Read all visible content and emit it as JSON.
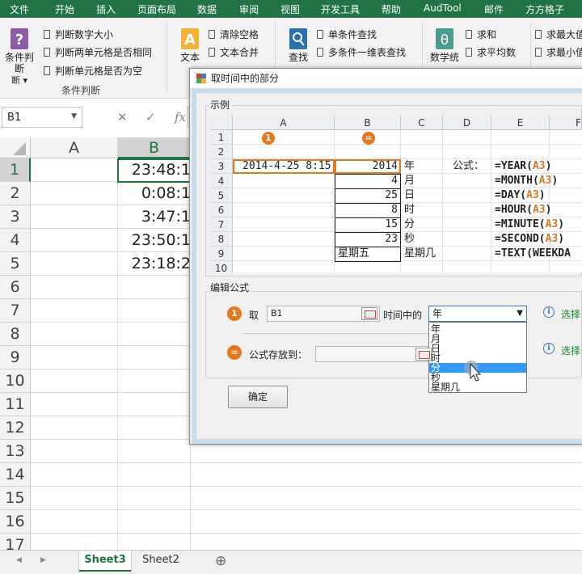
{
  "ribbon_tabs": [
    "文件",
    "开始",
    "插入",
    "页面布局",
    "数据",
    "审阅",
    "视图",
    "开发工具",
    "帮助",
    "AudTool",
    "邮件",
    "方方格子"
  ],
  "ribbon": {
    "cond_button": "条件判断",
    "cond_items": [
      "判断数字大小",
      "判断两单元格是否相同",
      "判断单元格是否为空"
    ],
    "cond_group_label": "条件判断",
    "text_button": "文本",
    "text_items": [
      "清除空格",
      "文本合并"
    ],
    "find_button": "查找",
    "find_items": [
      "单条件查找",
      "多条件一维表查找"
    ],
    "math_button": "数学统",
    "math_items": [
      "求和",
      "求平均数"
    ],
    "max_items": [
      "求最大值",
      "求最小值"
    ]
  },
  "formula_bar": {
    "name_box": "B1",
    "cancel_glyph": "✕",
    "enter_glyph": "✓",
    "fx_glyph": "fx"
  },
  "sheet": {
    "columns": [
      "A",
      "B"
    ],
    "rows": [
      "1",
      "2",
      "3",
      "4",
      "5",
      "6",
      "7",
      "8",
      "9",
      "10",
      "11",
      "12",
      "13",
      "14",
      "15",
      "16",
      "17"
    ],
    "b_values": [
      "23:48:1",
      "0:08:1",
      "3:47:1",
      "23:50:1",
      "23:18:2"
    ]
  },
  "sheet_tabs": {
    "prev_glyph": "◀",
    "next_glyph": "▶",
    "tabs": [
      "Sheet3",
      "Sheet2"
    ],
    "add_glyph": "⊕"
  },
  "dialog": {
    "title": "取时间中的部分",
    "example_label": "示例",
    "mini_cols": [
      "A",
      "B",
      "C",
      "D",
      "E",
      "F"
    ],
    "mini_rows": [
      "1",
      "2",
      "3",
      "4",
      "5",
      "6",
      "7",
      "8",
      "9",
      "10"
    ],
    "badge1": "1",
    "badge2": "=",
    "a3": "2014-4-25 8:15",
    "b_vals": [
      "2014",
      "4",
      "25",
      "8",
      "15",
      "23",
      "星期五"
    ],
    "c_vals": [
      "年",
      "月",
      "日",
      "时",
      "分",
      "秒",
      "星期几"
    ],
    "formula_label": "公式：",
    "formulas": [
      {
        "pre": "=YEAR(",
        "ref": "A3",
        "post": ")"
      },
      {
        "pre": "=MONTH(",
        "ref": "A3",
        "post": ")"
      },
      {
        "pre": "=DAY(",
        "ref": "A3",
        "post": ")"
      },
      {
        "pre": "=HOUR(",
        "ref": "A3",
        "post": ")"
      },
      {
        "pre": "=MINUTE(",
        "ref": "A3",
        "post": ")"
      },
      {
        "pre": "=SECOND(",
        "ref": "A3",
        "post": ")"
      },
      {
        "pre": "=TEXT(WEEKDA",
        "ref": "",
        "post": ""
      }
    ],
    "edit_label": "编辑公式",
    "take_label": "取",
    "source_value": "B1",
    "time_part_label": "时间中的",
    "combo_value": "年",
    "combo_arrow": "▼",
    "options": [
      "年",
      "月",
      "日",
      "时",
      "分",
      "秒",
      "星期几"
    ],
    "highlighted_option": "分",
    "select_hint": "选择",
    "store_label": "公式存放到：",
    "store_value": "",
    "info_glyph": "i",
    "ok_button": "确定"
  },
  "colors": {
    "excel_green": "#217346",
    "orange": "#e3781f",
    "highlight_blue": "#3399ff"
  }
}
